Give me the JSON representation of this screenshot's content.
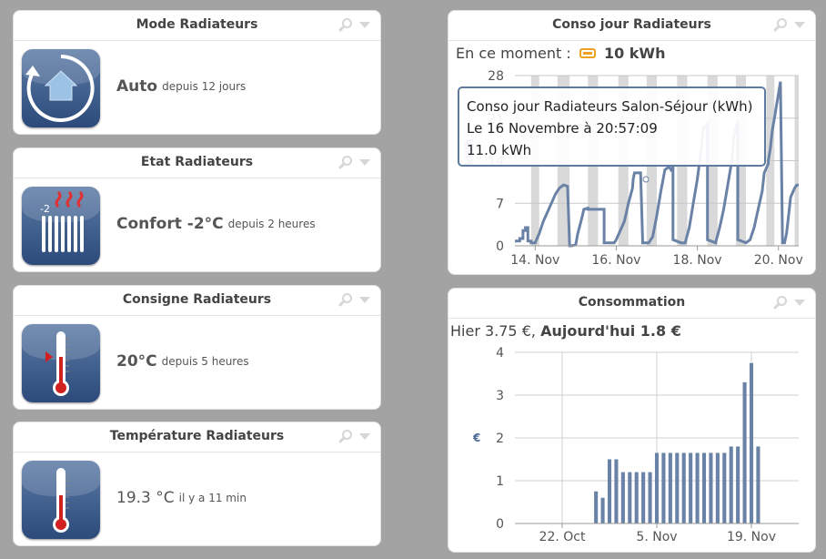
{
  "tiles": [
    {
      "title": "Mode Radiateurs",
      "value": "Auto",
      "since": "depuis 12 jours"
    },
    {
      "title": "Etat Radiateurs",
      "value": "Confort -2°C",
      "since": "depuis 2 heures",
      "icon_label": "-2"
    },
    {
      "title": "Consigne Radiateurs",
      "value": "20°C",
      "since": "depuis 5 heures"
    },
    {
      "title": "Température Radiateurs",
      "value": "19.3 °C",
      "since": "il y a 11 min"
    }
  ],
  "conso_jour": {
    "title": "Conso jour Radiateurs",
    "now_label": "En ce moment :",
    "now_value": "10 kWh",
    "yunit": "kWh",
    "tooltip": {
      "line1": "Conso jour Radiateurs Salon-Séjour (kWh)",
      "line2": "Le 16 Novembre à 20:57:09",
      "line3": "11.0 kWh"
    }
  },
  "consommation": {
    "title": "Consommation",
    "hier_label": "Hier 3.75 €,",
    "today_label": "Aujourd'hui 1.8 €",
    "yunit": "€"
  },
  "chart_data": [
    {
      "type": "line",
      "title": "Conso jour Radiateurs",
      "ylabel": "kWh",
      "ylim": [
        0,
        28
      ],
      "yticks": [
        0,
        7,
        14,
        21,
        28
      ],
      "xlim": [
        13.5,
        20.5
      ],
      "xticks": [
        14,
        16,
        18,
        20
      ],
      "xtick_labels": [
        "14. Nov",
        "16. Nov",
        "18. Nov",
        "20. Nov"
      ],
      "grid": true,
      "night_bands": [
        [
          13.9,
          14.1
        ],
        [
          14.55,
          14.85
        ],
        [
          15.3,
          15.55
        ],
        [
          16.05,
          16.3
        ],
        [
          16.75,
          17.0
        ],
        [
          17.5,
          17.75
        ],
        [
          18.25,
          18.5
        ],
        [
          18.95,
          19.2
        ],
        [
          19.7,
          19.9
        ],
        [
          20.4,
          20.5
        ]
      ],
      "series": [
        {
          "x": [
            13.5,
            13.62,
            13.62,
            13.7,
            13.7,
            13.76,
            13.76,
            13.82,
            13.82,
            13.9,
            13.9,
            14.0,
            14.0,
            14.1,
            14.2,
            14.3,
            14.4,
            14.5,
            14.6,
            14.7,
            14.8,
            14.85,
            14.9,
            14.9,
            15.0,
            15.05,
            15.15,
            15.2,
            15.3,
            15.3,
            15.6,
            15.7,
            15.7,
            15.95,
            16.0,
            16.2,
            16.3,
            16.4,
            16.42,
            16.45,
            16.5,
            16.6,
            16.65,
            16.65,
            16.8,
            16.9,
            17.0,
            17.1,
            17.2,
            17.3,
            17.35,
            17.4,
            17.4,
            17.6,
            17.7,
            17.8,
            17.9,
            18.0,
            18.1,
            18.15,
            18.25,
            18.25,
            18.45,
            18.55,
            18.65,
            18.75,
            18.85,
            18.9,
            19.0,
            19.0,
            19.2,
            19.3,
            19.4,
            19.5,
            19.6,
            19.65,
            19.75,
            19.75,
            19.8,
            19.85,
            19.9,
            20.0,
            20.05,
            20.1,
            20.15,
            20.2,
            20.25,
            20.3,
            20.4,
            20.45,
            20.5
          ],
          "y": [
            0.8,
            0.8,
            1.2,
            1.2,
            2.5,
            2.5,
            3.0,
            3.0,
            0.8,
            0.8,
            0.5,
            0.5,
            0.5,
            2.0,
            4.0,
            5.5,
            7.0,
            8.5,
            9.5,
            10.0,
            9.8,
            0,
            0,
            0,
            0.2,
            2.0,
            4.5,
            6.0,
            6.2,
            6.0,
            6.0,
            6.0,
            0.5,
            0.5,
            1.0,
            4.0,
            7.0,
            9.5,
            11.0,
            12.0,
            12.0,
            12.0,
            1.0,
            0.5,
            0.5,
            1.5,
            5.0,
            9.0,
            12.5,
            13.0,
            12.5,
            13.0,
            1.0,
            0.5,
            0.5,
            3.0,
            7.0,
            11.0,
            16.0,
            19.5,
            20.0,
            1.0,
            0.5,
            3.0,
            6.0,
            10.0,
            14.0,
            18.0,
            20.5,
            1.0,
            0.5,
            1.0,
            3.0,
            6.0,
            9.0,
            12.0,
            13.5,
            14.0,
            16.0,
            19.0,
            21.0,
            25.0,
            27.0,
            0.5,
            0.5,
            2.0,
            5.0,
            8.0,
            9.5,
            10.0,
            10.0
          ]
        }
      ]
    },
    {
      "type": "bar",
      "title": "Consommation",
      "ylabel": "€",
      "ylim": [
        0,
        4
      ],
      "yticks": [
        0,
        1,
        2,
        3,
        4
      ],
      "xtick_labels": [
        "22. Oct",
        "5. Nov",
        "19. Nov"
      ],
      "xticks_day": [
        22,
        36,
        50
      ],
      "grid": true,
      "series": [
        {
          "name": "Consommation",
          "day": [
            27,
            28,
            29,
            30,
            31,
            32,
            33,
            34,
            35,
            36,
            37,
            38,
            39,
            40,
            41,
            42,
            43,
            44,
            45,
            46,
            47,
            48,
            49,
            50,
            51
          ],
          "values": [
            0.75,
            0.6,
            1.5,
            1.5,
            1.2,
            1.2,
            1.2,
            1.2,
            1.2,
            1.65,
            1.65,
            1.65,
            1.65,
            1.65,
            1.65,
            1.65,
            1.65,
            1.65,
            1.65,
            1.65,
            1.8,
            1.8,
            3.3,
            3.75,
            1.8
          ]
        }
      ]
    }
  ]
}
